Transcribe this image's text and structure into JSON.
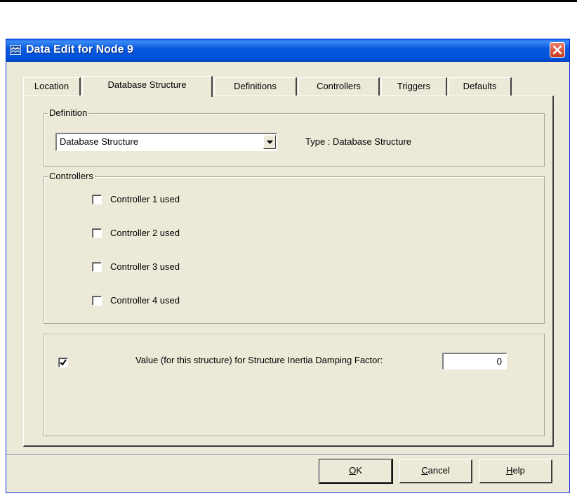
{
  "window": {
    "title": "Data Edit for Node 9"
  },
  "tabs": [
    {
      "label": "Location"
    },
    {
      "label": "Database Structure"
    },
    {
      "label": "Definitions"
    },
    {
      "label": "Controllers"
    },
    {
      "label": "Triggers"
    },
    {
      "label": "Defaults"
    }
  ],
  "definition": {
    "group_label": "Definition",
    "selected": "Database Structure",
    "type_text": "Type :  Database Structure"
  },
  "controllers": {
    "group_label": "Controllers",
    "items": [
      {
        "label": "Controller 1 used",
        "checked": false
      },
      {
        "label": "Controller 2 used",
        "checked": false
      },
      {
        "label": "Controller 3 used",
        "checked": false
      },
      {
        "label": "Controller 4 used",
        "checked": false
      }
    ]
  },
  "value_section": {
    "checked": true,
    "label": "Value (for this structure) for Structure Inertia Damping Factor:",
    "value": "0"
  },
  "buttons": {
    "ok_accel": "O",
    "ok_rest": "K",
    "cancel_accel": "C",
    "cancel_rest": "ancel",
    "help_accel": "H",
    "help_rest": "elp"
  },
  "colors": {
    "dialog_face": "#ece9d8",
    "titlebar": "#0050d8",
    "close": "#c83a1e"
  },
  "icons": [
    "app-icon",
    "close-icon",
    "dropdown-arrow-icon",
    "checkmark-icon"
  ]
}
